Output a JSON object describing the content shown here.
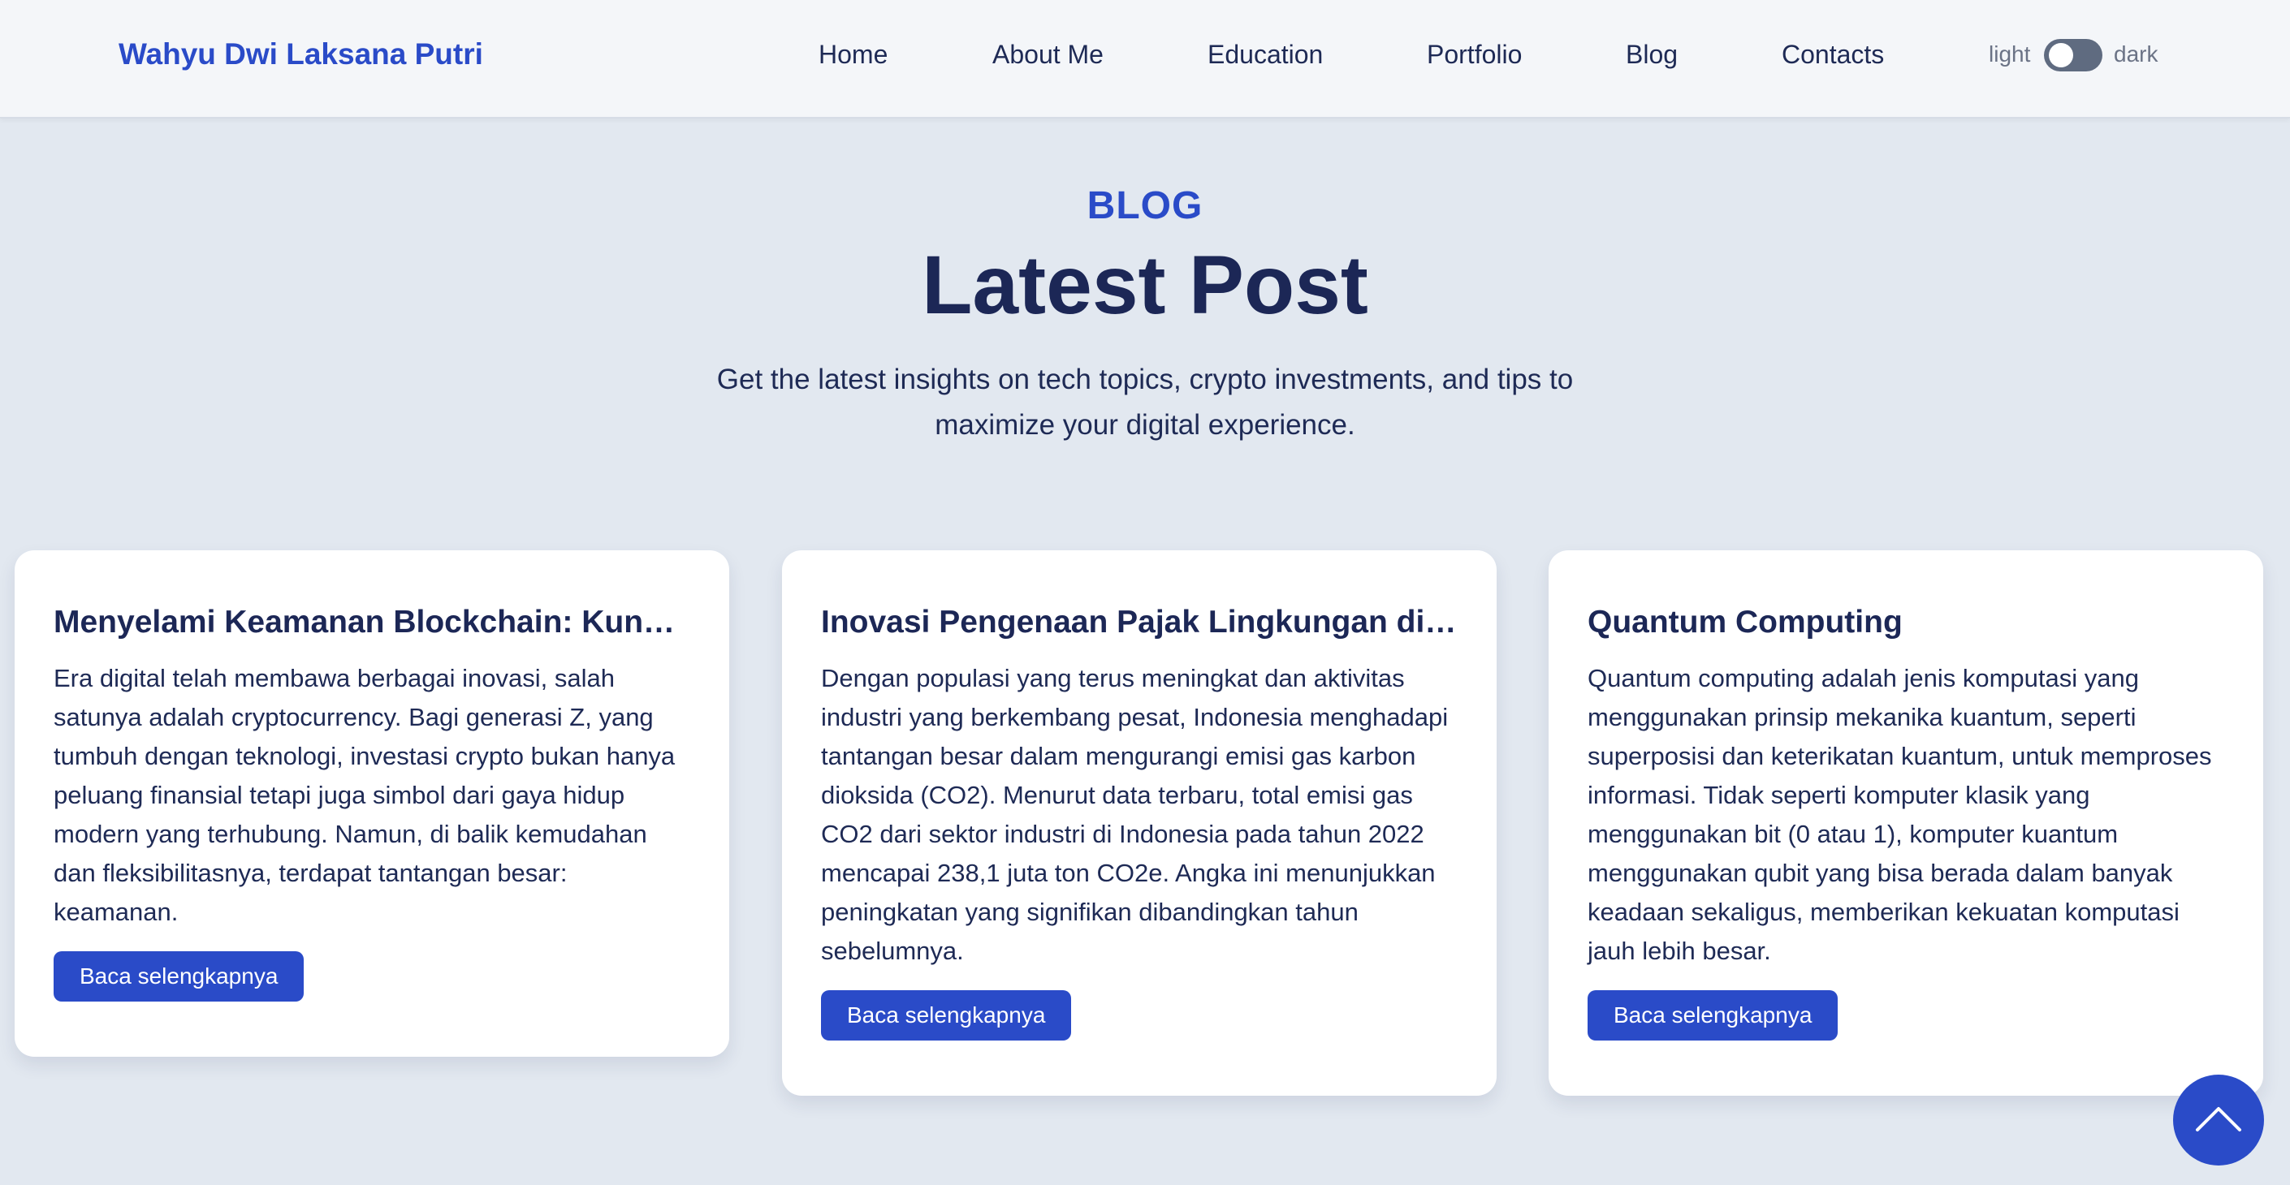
{
  "navbar": {
    "brand": "Wahyu Dwi Laksana Putri",
    "links": [
      "Home",
      "About Me",
      "Education",
      "Portfolio",
      "Blog",
      "Contacts"
    ],
    "theme": {
      "light_label": "light",
      "dark_label": "dark"
    }
  },
  "header": {
    "eyebrow": "BLOG",
    "title": "Latest Post",
    "subtitle": "Get the latest insights on tech topics, crypto investments, and tips to maximize your digital experience."
  },
  "posts": [
    {
      "title": "Menyelami Keamanan Blockchain: Kunci Investasi Crypto yang Aman",
      "excerpt": "Era digital telah membawa berbagai inovasi, salah satunya adalah cryptocurrency. Bagi generasi Z, yang tumbuh dengan teknologi, investasi crypto bukan hanya peluang finansial tetapi juga simbol dari gaya hidup modern yang terhubung. Namun, di balik kemudahan dan fleksibilitasnya, terdapat tantangan besar: keamanan.",
      "button": "Baca selengkapnya"
    },
    {
      "title": "Inovasi Pengenaan Pajak Lingkungan di Indonesia",
      "excerpt": "Dengan populasi yang terus meningkat dan aktivitas industri yang berkembang pesat, Indonesia menghadapi tantangan besar dalam mengurangi emisi gas karbon dioksida (CO2). Menurut data terbaru, total emisi gas CO2 dari sektor industri di Indonesia pada tahun 2022 mencapai 238,1 juta ton CO2e. Angka ini menunjukkan peningkatan yang signifikan dibandingkan tahun sebelumnya.",
      "button": "Baca selengkapnya"
    },
    {
      "title": "Quantum Computing",
      "excerpt": "Quantum computing adalah jenis komputasi yang menggunakan prinsip mekanika kuantum, seperti superposisi dan keterikatan kuantum, untuk memproses informasi. Tidak seperti komputer klasik yang menggunakan bit (0 atau 1), komputer kuantum menggunakan qubit yang bisa berada dalam banyak keadaan sekaligus, memberikan kekuatan komputasi jauh lebih besar.",
      "button": "Baca selengkapnya"
    }
  ],
  "scroll_top": {
    "icon": "chevron-up-icon"
  },
  "colors": {
    "accent": "#2a4bc8",
    "page_bg": "#e2e8f0",
    "navbar_bg": "#f4f6f9",
    "heading": "#1c2756"
  }
}
